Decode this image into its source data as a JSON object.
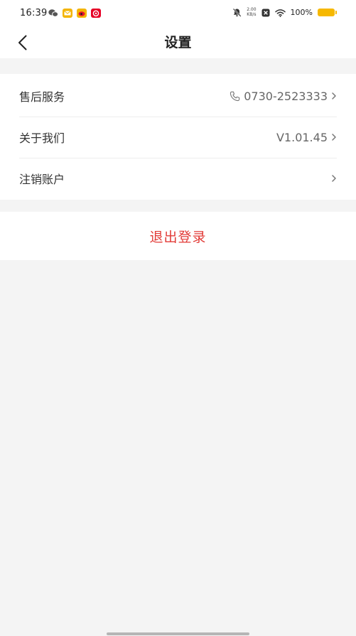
{
  "status_bar": {
    "time": "16:39",
    "net_speed_value": "2.00",
    "net_speed_unit": "KB/s",
    "battery_text": "100%"
  },
  "header": {
    "title": "设置"
  },
  "settings": {
    "items": [
      {
        "label": "售后服务",
        "value": "0730-2523333",
        "icon": "phone-icon"
      },
      {
        "label": "关于我们",
        "value": "V1.01.45"
      },
      {
        "label": "注销账户",
        "value": ""
      }
    ]
  },
  "logout": {
    "label": "退出登录",
    "color": "#e23b37"
  },
  "colors": {
    "background": "#f4f4f4",
    "card": "#ffffff",
    "battery": "#f6b800"
  }
}
